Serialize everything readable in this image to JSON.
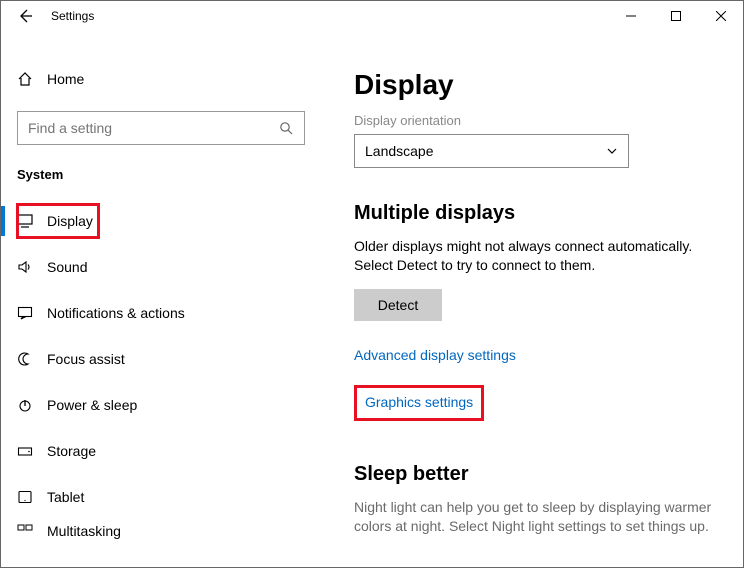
{
  "window": {
    "title": "Settings"
  },
  "sidebar": {
    "home": "Home",
    "search_placeholder": "Find a setting",
    "group": "System",
    "items": [
      {
        "label": "Display"
      },
      {
        "label": "Sound"
      },
      {
        "label": "Notifications & actions"
      },
      {
        "label": "Focus assist"
      },
      {
        "label": "Power & sleep"
      },
      {
        "label": "Storage"
      },
      {
        "label": "Tablet"
      },
      {
        "label": "Multitasking"
      }
    ]
  },
  "content": {
    "page_title": "Display",
    "orientation_label": "Display orientation",
    "orientation_value": "Landscape",
    "multiple_header": "Multiple displays",
    "multiple_body": "Older displays might not always connect automatically. Select Detect to try to connect to them.",
    "detect_label": "Detect",
    "link_advanced": "Advanced display settings",
    "link_graphics": "Graphics settings",
    "sleep_header": "Sleep better",
    "sleep_body": "Night light can help you get to sleep by displaying warmer colors at night. Select Night light settings to set things up."
  }
}
